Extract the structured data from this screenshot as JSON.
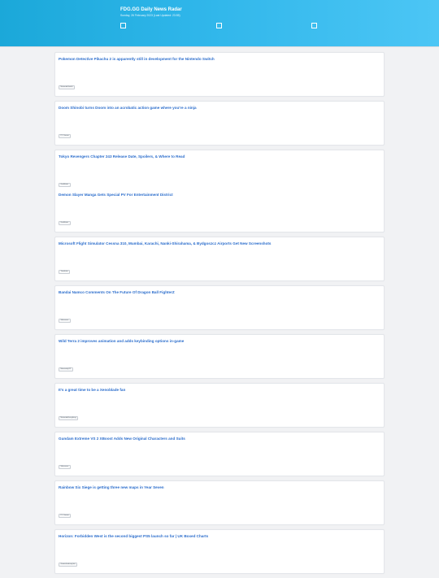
{
  "header": {
    "title": "FDG.GG Daily News Radar",
    "subtitle": "Sunday, 26 February 2023 (Last Updated: 23:55)"
  },
  "cards": [
    {
      "items": [
        {
          "title": "Pokemon Detective Pikachu 2 is apparently still in development for the Nintendo Switch",
          "source": "NintendoSwitch"
        }
      ]
    },
    {
      "items": [
        {
          "title": "Doom Shinobi turns Doom into an acrobatic action game where you're a ninja",
          "source": "PC Gamer"
        }
      ]
    },
    {
      "items": [
        {
          "title": "Tokyo Revengers Chapter 243 Release Date, Spoilers, & Where to Read",
          "source": "GadStatic"
        },
        {
          "title": "Demon Slayer Manga Gets Special PV For Entertainment District",
          "source": "GadStatic"
        }
      ]
    },
    {
      "items": [
        {
          "title": "Microsoft Flight Simulator Cessna 310, Mumbai, Karachi, Nanki-Shirahama, & Bydgoszcz Airports Get New Screenshots",
          "source": "Twinfinite"
        }
      ]
    },
    {
      "items": [
        {
          "title": "Bandai Namco Comments On The Future Of Dragon Ball FighterZ",
          "source": "Siliconera"
        }
      ]
    },
    {
      "items": [
        {
          "title": "Wild Terra 2 improves animation and adds keybinding options in-game",
          "source": "MassivelyOP"
        }
      ]
    },
    {
      "items": [
        {
          "title": "It's a great time to be a Xenoblade fan",
          "source": "NintendoEverything"
        }
      ]
    },
    {
      "items": [
        {
          "title": "Gundam Extreme VS 2 XBoost Adds New Original Characters and Suits",
          "source": "Siliconera"
        }
      ]
    },
    {
      "items": [
        {
          "title": "Rainbow Six Siege is getting three new maps in Year Seven",
          "source": "PC Gamer"
        }
      ]
    },
    {
      "items": [
        {
          "title": "Horizon: Forbidden West is the second biggest PS5 launch so far | UK Boxed Charts",
          "source": "GamesIndustry.biz"
        }
      ]
    }
  ]
}
